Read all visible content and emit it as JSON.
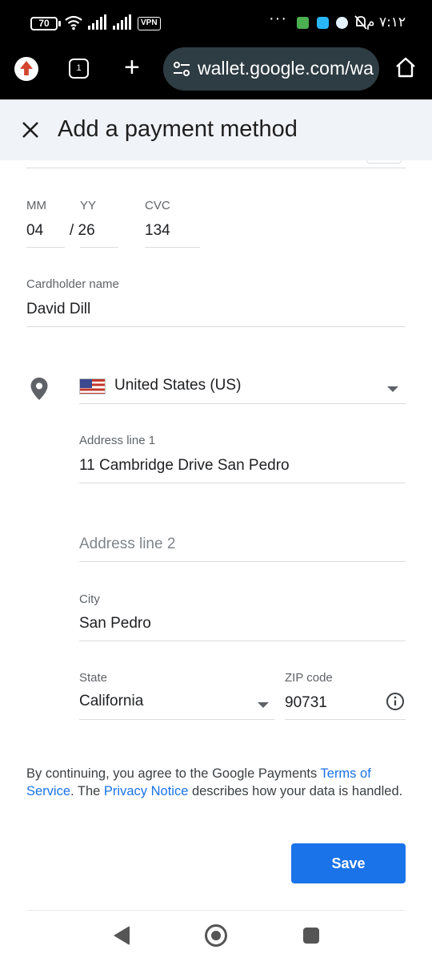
{
  "status_bar": {
    "battery": "70",
    "vpn": "VPN",
    "more": "···",
    "clock": "٧:١٢ م"
  },
  "browser": {
    "tabs_count": "1",
    "new_tab": "+",
    "url": "wallet.google.com/wa"
  },
  "header": {
    "title": "Add a payment method"
  },
  "card": {
    "month_label": "MM",
    "month_value": "04",
    "year_label": "YY",
    "year_value": "/ 26",
    "cvc_label": "CVC",
    "cvc_value": "134",
    "name_label": "Cardholder name",
    "name_value": "David Dill"
  },
  "address": {
    "country": "United States (US)",
    "line1_label": "Address line 1",
    "line1_value": "11 Cambridge Drive San Pedro",
    "line2_placeholder": "Address line 2",
    "city_label": "City",
    "city_value": "San Pedro",
    "state_label": "State",
    "state_value": "California",
    "zip_label": "ZIP code",
    "zip_value": "90731"
  },
  "terms": {
    "part1": "By continuing, you agree to the Google Payments ",
    "tos_link": "Terms of Service",
    "part2": ". The ",
    "privacy_link": "Privacy Notice",
    "part3": " describes how your data is handled."
  },
  "actions": {
    "save_label": "Save"
  },
  "colors": {
    "accent": "#1a73e8",
    "header_bg": "#f0f3f8",
    "url_bar_bg": "#2e3c43"
  }
}
